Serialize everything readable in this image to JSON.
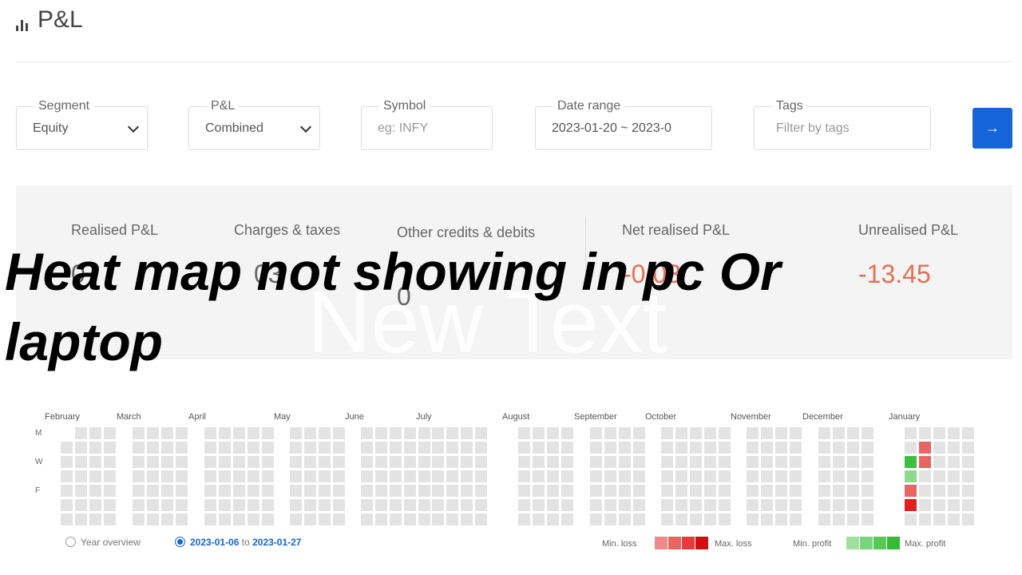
{
  "header": {
    "title": "P&L",
    "icon": "bar-chart-icon"
  },
  "filters": {
    "segment": {
      "label": "Segment",
      "value": "Equity"
    },
    "pnl": {
      "label": "P&L",
      "value": "Combined"
    },
    "symbol": {
      "label": "Symbol",
      "placeholder": "eg: INFY"
    },
    "date_range": {
      "label": "Date range",
      "value": "2023-01-20 ~ 2023-0"
    },
    "tags": {
      "label": "Tags",
      "placeholder": "Filter by tags"
    },
    "go_icon": "→"
  },
  "summary": {
    "realised": {
      "label": "Realised P&L",
      "value": "0"
    },
    "charges": {
      "label": "Charges & taxes",
      "value": "03"
    },
    "other_credits": {
      "label": "Other credits & debits",
      "value": "0"
    },
    "net_realised": {
      "label": "Net realised P&L",
      "value": "-0.03"
    },
    "unrealised": {
      "label": "Unrealised P&L",
      "value": "-13.45"
    },
    "ghost_text": "New Text"
  },
  "overlay_text": "Heat map not showing in pc Or laptop",
  "heatmap": {
    "months": [
      "February",
      "March",
      "April",
      "May",
      "June",
      "July",
      "August",
      "September",
      "October",
      "November",
      "December",
      "January"
    ],
    "day_labels": [
      "M",
      "W",
      "F"
    ],
    "colors": {
      "empty": "#e3e3e3",
      "loss_max": "#e0211f",
      "loss_mid": "#e66565",
      "profit_max": "#3fbf3f",
      "profit_min": "#8fd88f"
    },
    "colored_cells": [
      {
        "week": "2023-01-09",
        "weekday": "Tue",
        "level": "loss_mid"
      },
      {
        "week": "2023-01-09",
        "weekday": "Wed",
        "level": "loss_mid"
      },
      {
        "week": "2023-01-02",
        "weekday": "Wed",
        "level": "profit_max"
      },
      {
        "week": "2023-01-02",
        "weekday": "Thu",
        "level": "profit_min"
      },
      {
        "week": "2023-01-02",
        "weekday": "Fri",
        "level": "loss_mid"
      },
      {
        "week": "2023-01-02",
        "weekday": "Sat",
        "level": "loss_max"
      }
    ]
  },
  "range_options": {
    "year_overview": "Year overview",
    "from": "2023-01-06",
    "to_word": "to",
    "to": "2023-01-27"
  },
  "legend": {
    "min_loss": "Min. loss",
    "max_loss": "Max. loss",
    "min_profit": "Min. profit",
    "max_profit": "Max. profit",
    "loss_colors": [
      "#f08a8a",
      "#ea6464",
      "#e23c3c",
      "#d01010"
    ],
    "profit_colors": [
      "#9fe09f",
      "#7bd47b",
      "#58c858",
      "#35bb35"
    ]
  }
}
